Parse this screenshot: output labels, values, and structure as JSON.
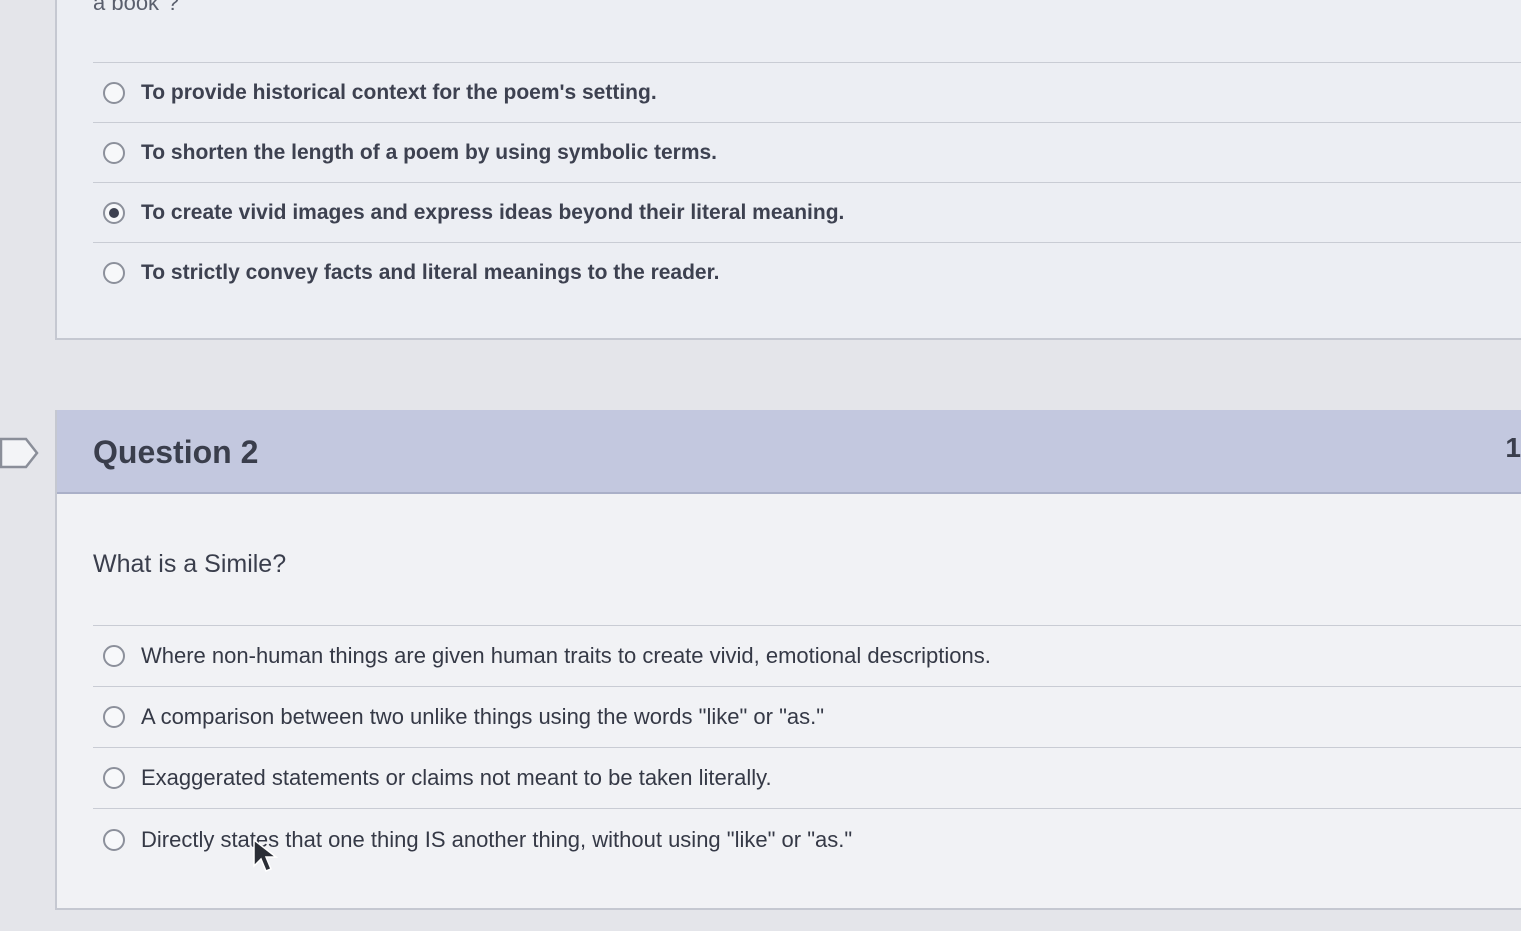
{
  "question1": {
    "prompt_tail": "a book\"?",
    "answers": [
      {
        "label": "To provide historical context for the poem's setting.",
        "selected": false
      },
      {
        "label": "To shorten the length of a poem by using symbolic terms.",
        "selected": false
      },
      {
        "label": "To create vivid images and express ideas beyond their literal meaning.",
        "selected": true
      },
      {
        "label": "To strictly convey facts and literal meanings to the reader.",
        "selected": false
      }
    ]
  },
  "question2": {
    "title": "Question 2",
    "points": "1",
    "prompt": "What is a Simile?",
    "answers": [
      {
        "label": "Where non-human things are given human traits to create vivid, emotional descriptions.",
        "selected": false
      },
      {
        "label": "A comparison between two unlike things using the words \"like\" or \"as.\"",
        "selected": false
      },
      {
        "label": "Exaggerated statements or claims not meant to be taken literally.",
        "selected": false
      },
      {
        "label": "Directly states that one thing IS another thing, without using \"like\" or \"as.\"",
        "selected": false
      }
    ]
  },
  "icons": {
    "flag": "flag-question-icon",
    "cursor": "mouse-pointer-icon"
  },
  "colors": {
    "header_bg": "#c3c8df",
    "panel_bg": "#f1f2f5",
    "page_bg": "#e4e5ea"
  }
}
